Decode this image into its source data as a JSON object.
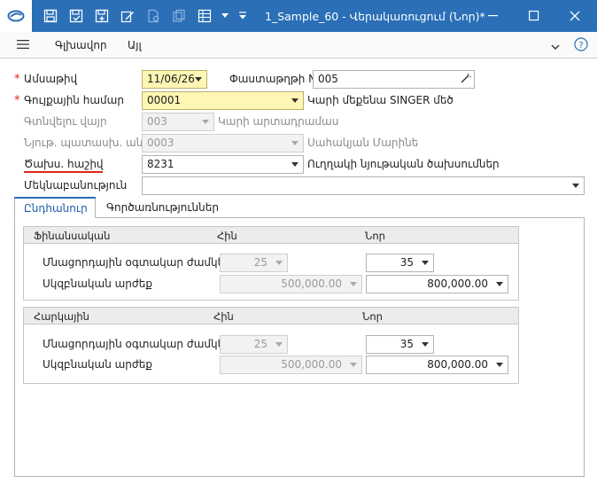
{
  "window": {
    "title": "1_Sample_60 - Վերակառուցում (Նոր)*"
  },
  "menu": {
    "items": [
      "Գլխավոր",
      "Այլ"
    ]
  },
  "form": {
    "date": {
      "label": "Ամսաթիվ",
      "value": "11/06/26"
    },
    "doc_number": {
      "label": "Փաստաթղթի N",
      "value": "005"
    },
    "inventory_number": {
      "label": "Գույքային համար",
      "value": "00001",
      "description": "Կարի մեքենա SINGER մեծ"
    },
    "location": {
      "label": "Գտնվելու վայր",
      "value": "003",
      "description": "Կարի արտադրամաս"
    },
    "responsible": {
      "label": "Նյութ. պատասխ. անձ",
      "value": "0003",
      "description": "Սահակյան Մարինե"
    },
    "expense_account": {
      "label": "Ծախս. հաշիվ",
      "value": "8231",
      "description": "Ուղղակի նյութական ծախսումներ"
    },
    "comment": {
      "label": "Մեկնաբանություն",
      "value": ""
    }
  },
  "tabs": [
    "Ընդհանուր",
    "Գործառնություններ"
  ],
  "groups": [
    {
      "title": "Ֆինանսական",
      "col_old": "Հին",
      "col_new": "Նոր",
      "rows": [
        {
          "label": "Մնացորդային օգտակար ժամկետ",
          "old": "25",
          "new": "35"
        },
        {
          "label": "Սկզբնական արժեք",
          "old": "500,000.00",
          "new": "800,000.00"
        }
      ]
    },
    {
      "title": "Հարկային",
      "col_old": "Հին",
      "col_new": "Նոր",
      "rows": [
        {
          "label": "Մնացորդային օգտակար ժամկետ",
          "old": "25",
          "new": "35"
        },
        {
          "label": "Սկզբնական արժեք",
          "old": "500,000.00",
          "new": "800,000.00"
        }
      ]
    }
  ],
  "colors": {
    "titlebar": "#2b6fb7",
    "required": "#d9261c",
    "highlight_field": "#fdf6b4",
    "tab_accent": "#2b6fb7"
  }
}
